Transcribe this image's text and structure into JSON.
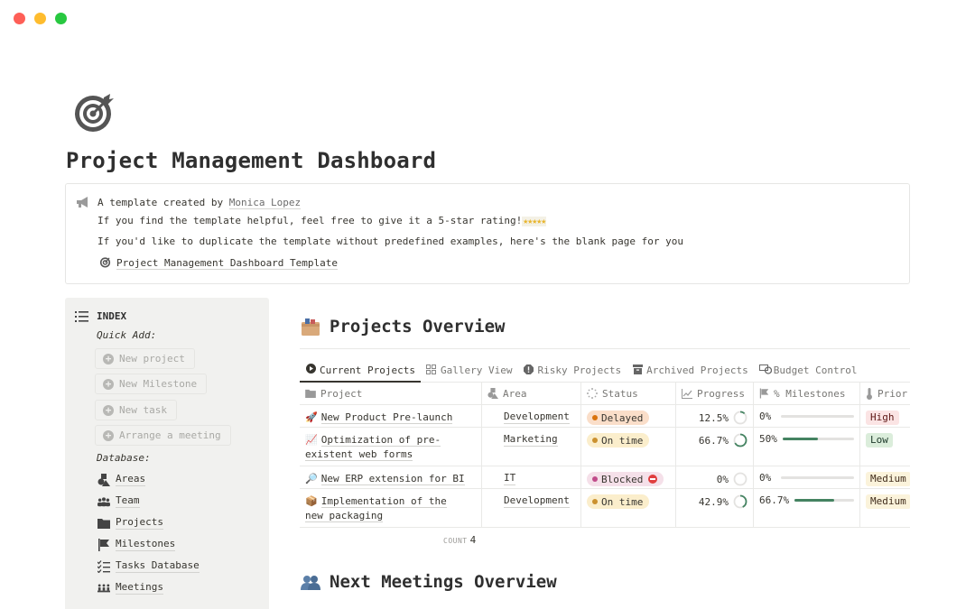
{
  "window": {
    "controls": [
      "close",
      "minimize",
      "maximize"
    ]
  },
  "page": {
    "icon": "target-icon",
    "title": "Project Management Dashboard"
  },
  "callout": {
    "icon": "megaphone-icon",
    "line1_prefix": "A template created by ",
    "author": "Monica Lopez",
    "line2": "If you find the template helpful, feel free to give it a 5-star rating!",
    "stars": "★★★★★",
    "line3": "If you'd like to duplicate the template without predefined examples, here's the blank page for you",
    "template_link": "Project Management Dashboard Template"
  },
  "sidebar": {
    "title": "INDEX",
    "quick_add_label": "Quick Add:",
    "quick_add": [
      {
        "label": "New project"
      },
      {
        "label": "New Milestone"
      },
      {
        "label": "New task"
      },
      {
        "label": "Arrange a meeting"
      }
    ],
    "database_label": "Database:",
    "databases": [
      {
        "label": "Areas",
        "icon": "shapes-icon"
      },
      {
        "label": "Team",
        "icon": "people-group-icon"
      },
      {
        "label": "Projects",
        "icon": "folder-icon"
      },
      {
        "label": "Milestones",
        "icon": "flag-icon"
      },
      {
        "label": "Tasks Database",
        "icon": "checklist-icon"
      },
      {
        "label": "Meetings",
        "icon": "meeting-icon"
      }
    ]
  },
  "projects_section": {
    "title": "Projects Overview",
    "icon": "card-box-icon",
    "tabs": [
      {
        "label": "Current Projects",
        "icon": "play-circle-icon",
        "active": true
      },
      {
        "label": "Gallery View",
        "icon": "grid-icon"
      },
      {
        "label": "Risky Projects",
        "icon": "alert-icon"
      },
      {
        "label": "Archived Projects",
        "icon": "archive-icon"
      },
      {
        "label": "Budget Control",
        "icon": "money-icon"
      }
    ],
    "columns": [
      "Project",
      "Area",
      "Status",
      "Progress",
      "% Milestones",
      "Prior"
    ],
    "rows": [
      {
        "emoji": "🚀",
        "project": "New Product Pre-launch",
        "area": "Development",
        "status": "Delayed",
        "progress": "12.5%",
        "progress_value": 0.125,
        "milestones": "0%",
        "milestones_value": 0,
        "priority": "High"
      },
      {
        "emoji": "📈",
        "project": "Optimization of pre-existent web forms",
        "project_l1": "Optimization of pre-",
        "project_l2": "existent web forms",
        "area": "Marketing",
        "status": "On time",
        "progress": "66.7%",
        "progress_value": 0.667,
        "milestones": "50%",
        "milestones_value": 0.5,
        "priority": "Low"
      },
      {
        "emoji": "🔎",
        "project": "New ERP extension for BI",
        "area": "IT",
        "status": "Blocked",
        "progress": "0%",
        "progress_value": 0,
        "milestones": "0%",
        "milestones_value": 0,
        "priority": "Medium"
      },
      {
        "emoji": "📦",
        "project": "Implementation of the new packaging",
        "project_l1": "Implementation of the",
        "project_l2": "new packaging",
        "area": "Development",
        "status": "On time",
        "progress": "42.9%",
        "progress_value": 0.429,
        "milestones": "66.7%",
        "milestones_value": 0.667,
        "priority": "Medium"
      }
    ],
    "count_label": "COUNT",
    "count": "4"
  },
  "meetings_section": {
    "title": "Next Meetings Overview",
    "icon": "busts-icon"
  },
  "colors": {
    "progress_green": "#448361",
    "ring_track": "#e3e2e0"
  }
}
